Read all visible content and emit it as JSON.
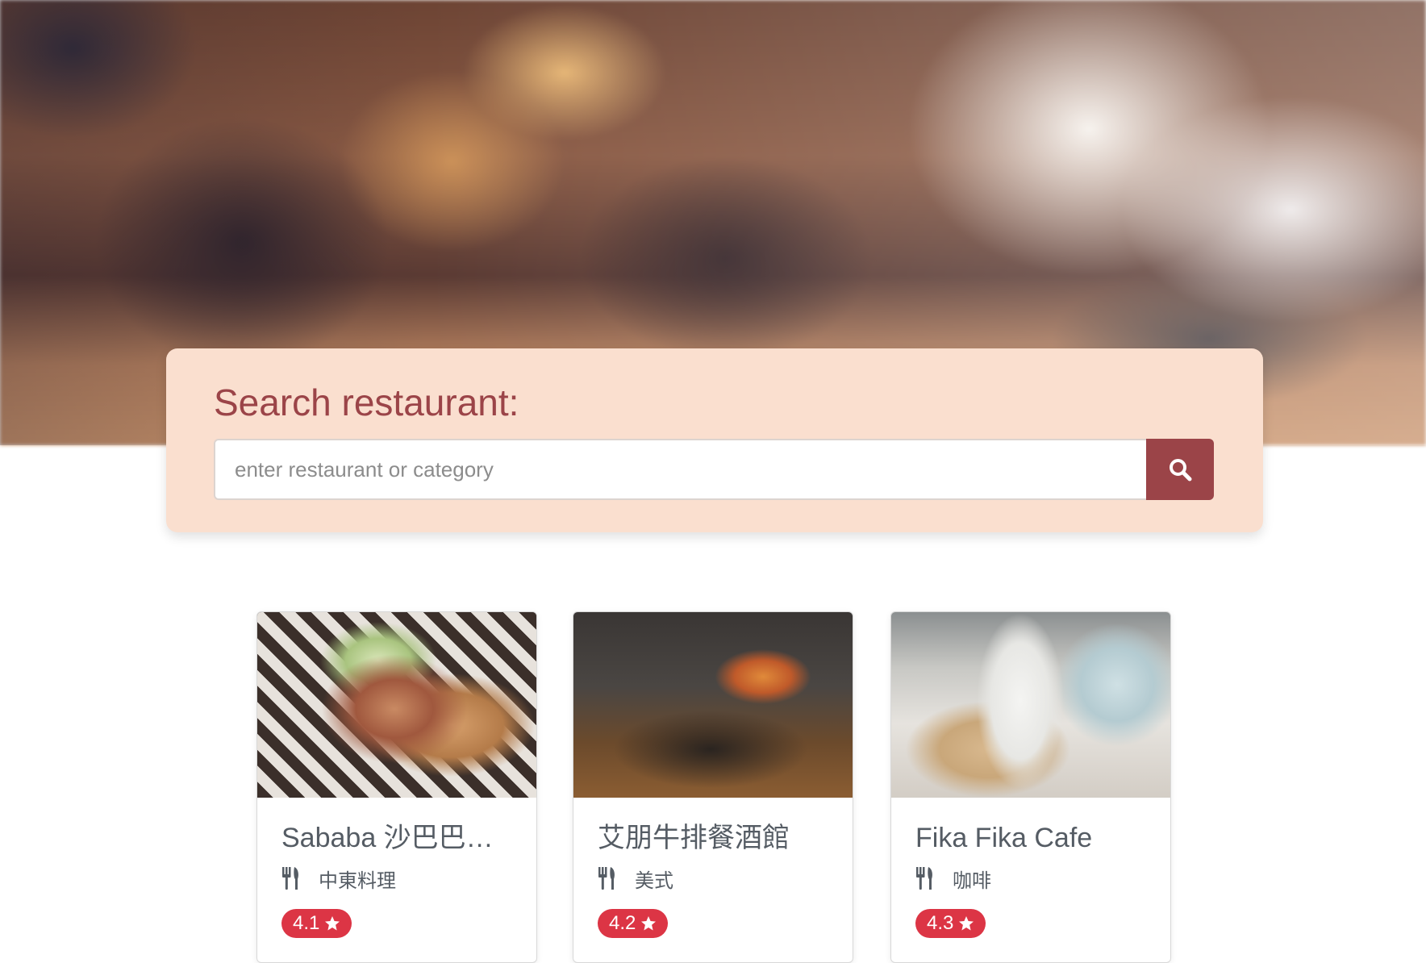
{
  "search": {
    "title": "Search restaurant:",
    "placeholder": "enter restaurant or category",
    "value": "",
    "button_icon": "search-icon"
  },
  "colors": {
    "accent": "#9b4448",
    "panel": "#fadfcf",
    "badge": "#dc3545",
    "text": "#555c64"
  },
  "restaurants": [
    {
      "name": "Sababa 沙巴巴中...",
      "category_icon": "utensils-icon",
      "category": "中東料理",
      "rating": "4.1",
      "rating_icon": "star-icon"
    },
    {
      "name": "艾朋牛排餐酒館",
      "category_icon": "utensils-icon",
      "category": "美式",
      "rating": "4.2",
      "rating_icon": "star-icon"
    },
    {
      "name": "Fika Fika Cafe",
      "category_icon": "utensils-icon",
      "category": "咖啡",
      "rating": "4.3",
      "rating_icon": "star-icon"
    }
  ]
}
